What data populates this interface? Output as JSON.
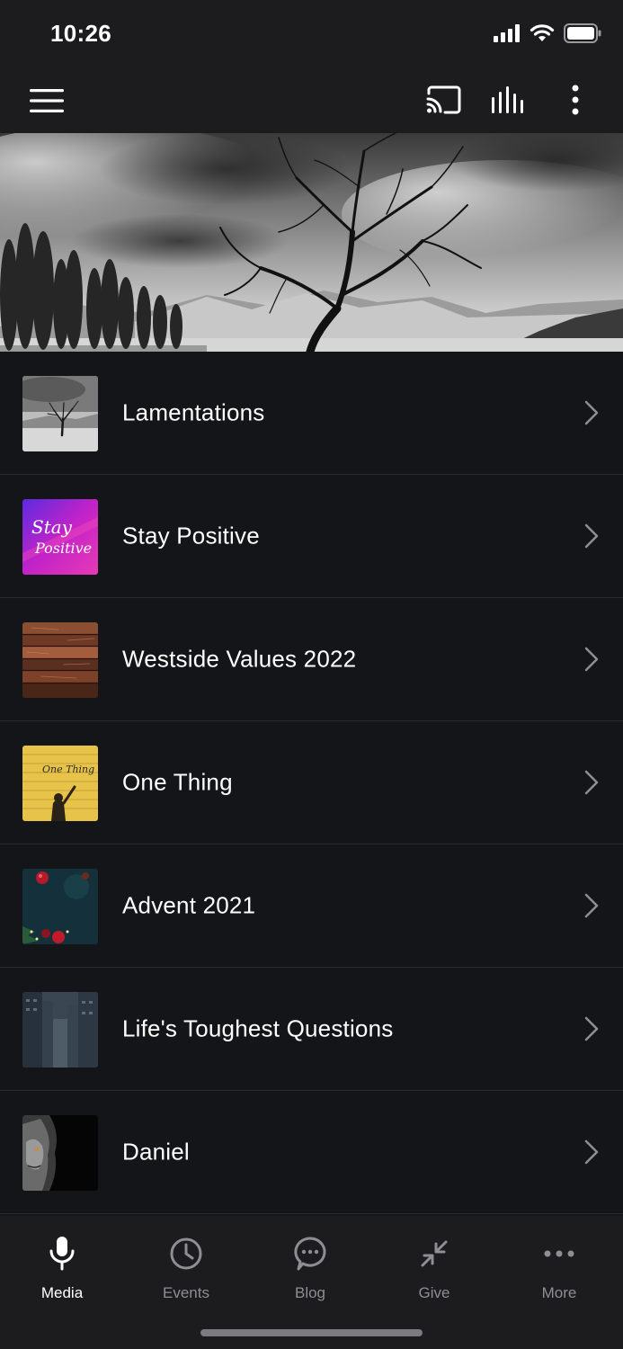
{
  "status_bar": {
    "time": "10:26"
  },
  "top_bar": {
    "menu_icon": "hamburger-menu-icon",
    "cast_icon": "cast-icon",
    "audio_icon": "audio-bars-icon",
    "more_icon": "vertical-ellipsis-icon"
  },
  "hero": {
    "image": "black-and-white lone tree landscape"
  },
  "series": [
    {
      "title": "Lamentations",
      "thumb": "lone-tree"
    },
    {
      "title": "Stay Positive",
      "thumb": "stay-positive",
      "thumb_text_1": "Stay",
      "thumb_text_2": "Positive"
    },
    {
      "title": "Westside Values 2022",
      "thumb": "wood-planks"
    },
    {
      "title": "One Thing",
      "thumb": "yellow-wall",
      "thumb_text_1": "One Thing"
    },
    {
      "title": "Advent 2021",
      "thumb": "advent-ornaments"
    },
    {
      "title": "Life's Toughest Questions",
      "thumb": "city-street"
    },
    {
      "title": "Daniel",
      "thumb": "lion"
    }
  ],
  "tabs": [
    {
      "label": "Media",
      "icon": "microphone-icon",
      "active": true
    },
    {
      "label": "Events",
      "icon": "clock-icon",
      "active": false
    },
    {
      "label": "Blog",
      "icon": "chat-bubble-icon",
      "active": false
    },
    {
      "label": "Give",
      "icon": "compress-arrows-icon",
      "active": false
    },
    {
      "label": "More",
      "icon": "horizontal-ellipsis-icon",
      "active": false
    }
  ],
  "colors": {
    "background": "#141518",
    "bar": "#1c1c1e",
    "active_tab": "#ffffff",
    "inactive_tab": "#8e8e93"
  }
}
